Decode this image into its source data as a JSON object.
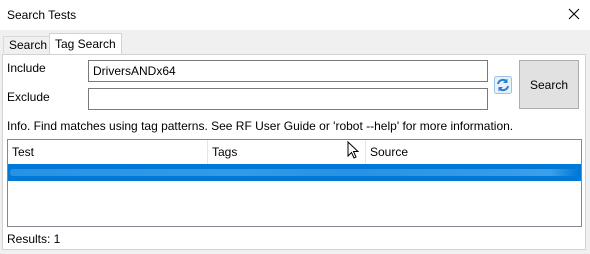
{
  "window": {
    "title": "Search Tests"
  },
  "tabs": [
    {
      "label": "Search",
      "active": false
    },
    {
      "label": "Tag Search",
      "active": true
    }
  ],
  "form": {
    "include_label": "Include",
    "include_value": "DriversANDx64",
    "exclude_label": "Exclude",
    "exclude_value": "",
    "search_button": "Search"
  },
  "info_text": "Info. Find matches using tag patterns. See RF User Guide or 'robot --help' for more information.",
  "results_table": {
    "columns": [
      "Test",
      "Tags",
      "Source"
    ],
    "rows": [
      {
        "test": "",
        "tags": "",
        "source": "",
        "selected": true
      }
    ]
  },
  "status": {
    "results_text": "Results: 1"
  },
  "colors": {
    "selection": "#0078d7",
    "refresh_icon": "#2a7fd4"
  },
  "icons": {
    "close": "close-icon",
    "refresh": "refresh-icon",
    "cursor": "mouse-cursor-icon"
  }
}
